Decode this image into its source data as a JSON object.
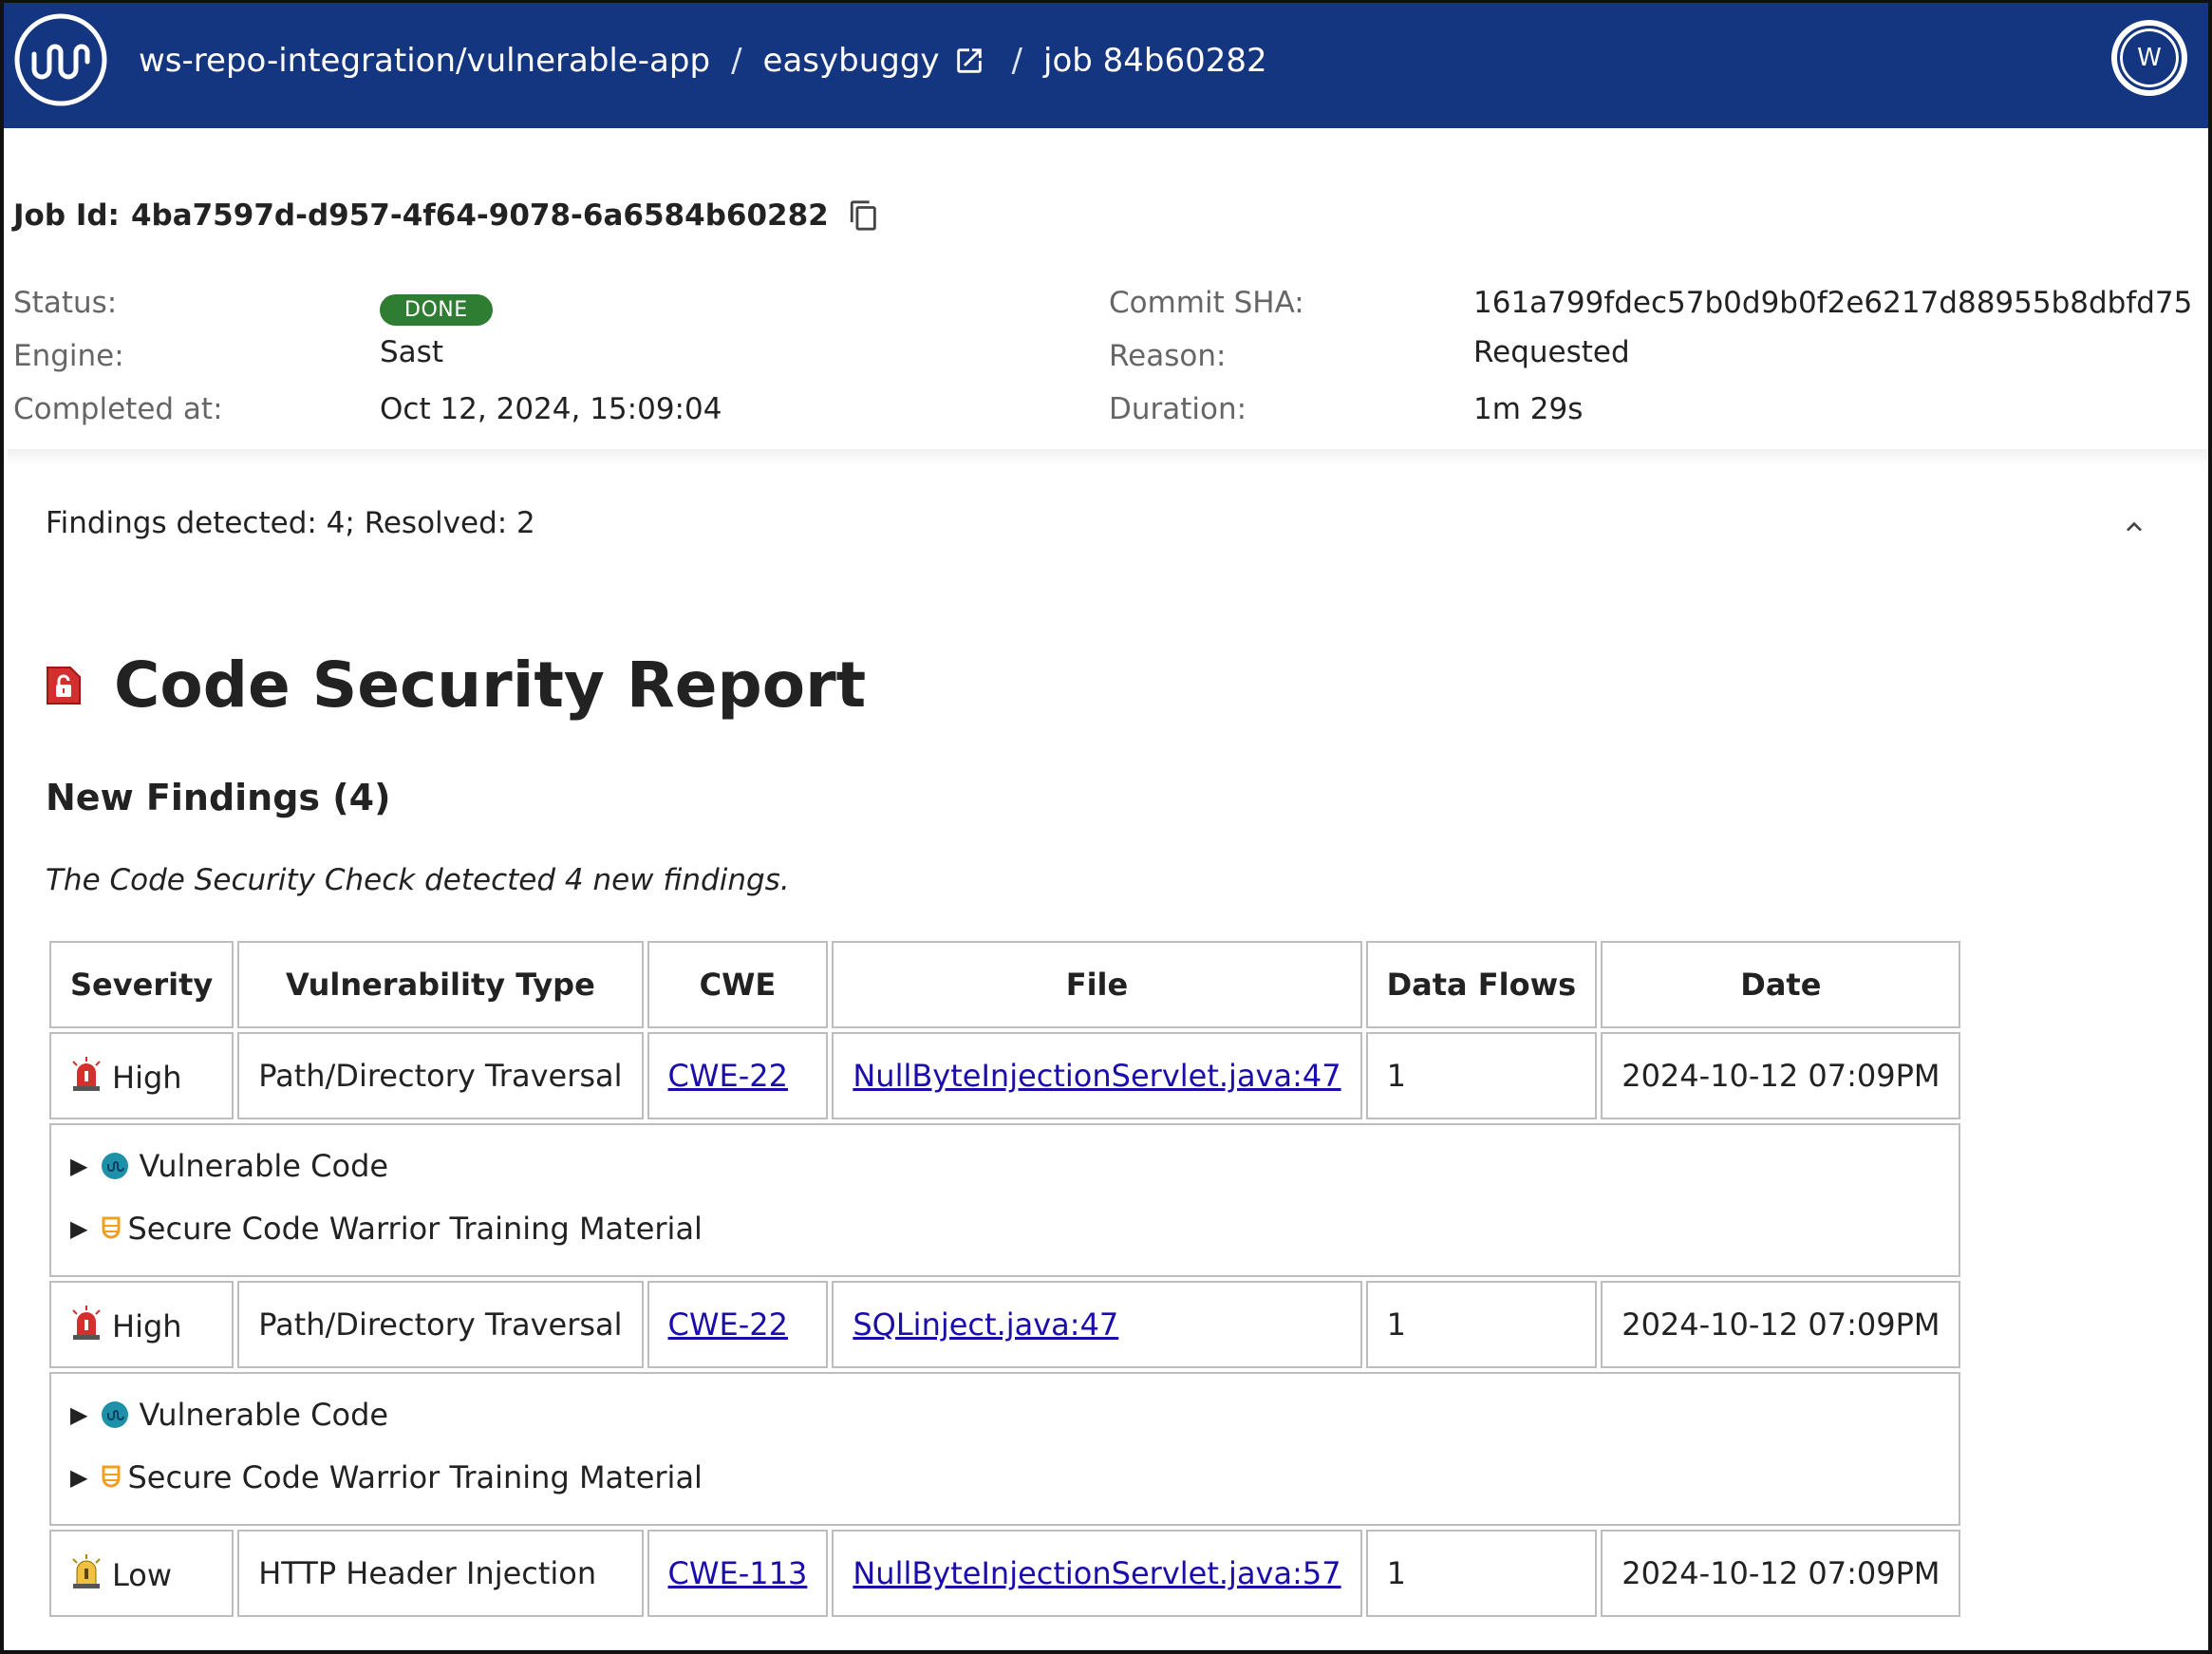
{
  "header": {
    "breadcrumb": {
      "org_repo": "ws-repo-integration/vulnerable-app",
      "separator": "/",
      "project": "easybuggy",
      "job": "job 84b60282"
    },
    "avatar_letter": "W",
    "icons": {
      "logo": "mend-wave-logo",
      "external": "external-link-icon"
    }
  },
  "job": {
    "id_label": "Job Id:",
    "id_value": "4ba7597d-d957-4f64-9078-6a6584b60282",
    "fields": {
      "status_label": "Status:",
      "status_value": "DONE",
      "engine_label": "Engine:",
      "engine_value": "Sast",
      "completed_label": "Completed at:",
      "completed_value": "Oct 12, 2024, 15:09:04",
      "commit_label": "Commit SHA:",
      "commit_value": "161a799fdec57b0d9b0f2e6217d88955b8dbfd75",
      "reason_label": "Reason:",
      "reason_value": "Requested",
      "duration_label": "Duration:",
      "duration_value": "1m 29s"
    },
    "status_color": "#2e7d32"
  },
  "findings_panel": {
    "summary": "Findings detected: 4; Resolved: 2"
  },
  "report": {
    "title": "Code Security Report",
    "subtitle": "New Findings (4)",
    "description": "The Code Security Check detected 4 new findings.",
    "columns": [
      "Severity",
      "Vulnerability Type",
      "CWE",
      "File",
      "Data Flows",
      "Date"
    ],
    "rows": [
      {
        "severity": "High",
        "type": "Path/Directory Traversal",
        "cwe": "CWE-22",
        "file": "NullByteInjectionServlet.java:47",
        "flows": "1",
        "date": "2024-10-12 07:09PM",
        "detail_1": "Vulnerable Code",
        "detail_2": "Secure Code Warrior Training Material"
      },
      {
        "severity": "High",
        "type": "Path/Directory Traversal",
        "cwe": "CWE-22",
        "file": "SQLinject.java:47",
        "flows": "1",
        "date": "2024-10-12 07:09PM",
        "detail_1": "Vulnerable Code",
        "detail_2": "Secure Code Warrior Training Material"
      },
      {
        "severity": "Low",
        "type": "HTTP Header Injection",
        "cwe": "CWE-113",
        "file": "NullByteInjectionServlet.java:57",
        "flows": "1",
        "date": "2024-10-12 07:09PM"
      }
    ],
    "colors": {
      "high": "#d32f2f",
      "low": "#f0c040",
      "link": "#1a0dab"
    }
  }
}
